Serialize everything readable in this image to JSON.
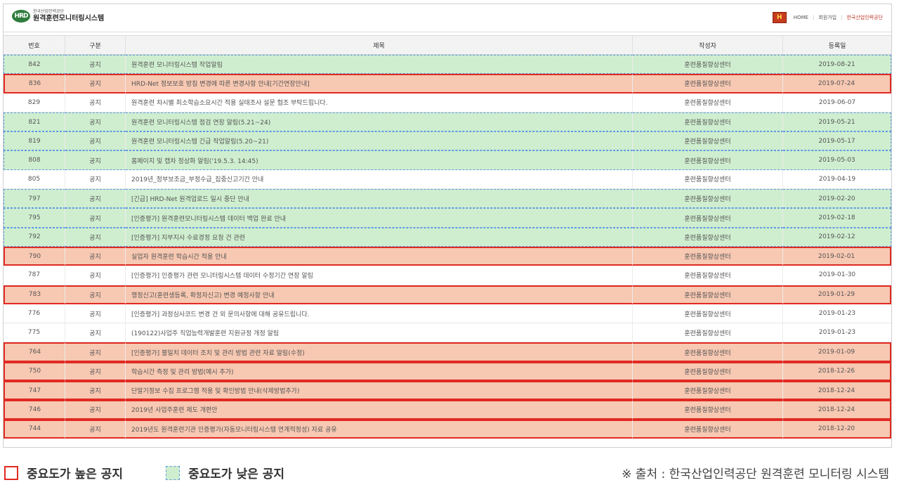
{
  "header": {
    "logo_small": "한국산업인력공단",
    "logo_main": "원격훈련모니터링시스템",
    "logo_mark": "HRD",
    "badge": "H",
    "links": [
      "HOME",
      "회원가입",
      "한국산업인력공단"
    ]
  },
  "table": {
    "columns": [
      "번호",
      "구분",
      "제목",
      "작성자",
      "등록일"
    ],
    "rows": [
      {
        "no": "842",
        "type": "공지",
        "title": "원격훈련 모니터링시스템 작업알림",
        "author": "훈련품질향상센터",
        "date": "2019-08-21",
        "importance": "low"
      },
      {
        "no": "836",
        "type": "공지",
        "title": "HRD-Net 정보보호 방침 변경에 따른 변경사항 안내[기간연장안내]",
        "author": "훈련품질향상센터",
        "date": "2019-07-24",
        "importance": "high"
      },
      {
        "no": "829",
        "type": "공지",
        "title": "원격훈련 차시별 최소학습소요시간 적용 실태조사 설문 협조 부탁드립니다.",
        "author": "훈련품질향상센터",
        "date": "2019-06-07",
        "importance": "none"
      },
      {
        "no": "821",
        "type": "공지",
        "title": "원격훈련 모니터링시스템 점검 연장 알림(5.21~24)",
        "author": "훈련품질향상센터",
        "date": "2019-05-21",
        "importance": "low"
      },
      {
        "no": "819",
        "type": "공지",
        "title": "원격훈련 모니터링시스템 긴급 작업알림(5.20~21)",
        "author": "훈련품질향상센터",
        "date": "2019-05-17",
        "importance": "low"
      },
      {
        "no": "808",
        "type": "공지",
        "title": "홈페이지 및 캡차 정상화 알림('19.5.3. 14:45)",
        "author": "훈련품질향상센터",
        "date": "2019-05-03",
        "importance": "low"
      },
      {
        "no": "805",
        "type": "공지",
        "title": "2019년_정부보조금_부정수급_집중신고기간 안내",
        "author": "훈련품질향상센터",
        "date": "2019-04-19",
        "importance": "none"
      },
      {
        "no": "797",
        "type": "공지",
        "title": "[긴급] HRD-Net 원격업로드 일시 중단 안내",
        "author": "훈련품질향상센터",
        "date": "2019-02-20",
        "importance": "low"
      },
      {
        "no": "795",
        "type": "공지",
        "title": "[인증평가] 원격훈련모니터링시스템 데이터 백업 완료 안내",
        "author": "훈련품질향상센터",
        "date": "2019-02-18",
        "importance": "low"
      },
      {
        "no": "792",
        "type": "공지",
        "title": "[인증평가] 지부지사 수료경정 요청 건 관련",
        "author": "훈련품질향상센터",
        "date": "2019-02-12",
        "importance": "low"
      },
      {
        "no": "790",
        "type": "공지",
        "title": "실업자 원격훈련 학습시간 적용 안내",
        "author": "훈련품질향상센터",
        "date": "2019-02-01",
        "importance": "high"
      },
      {
        "no": "787",
        "type": "공지",
        "title": "[인증평가] 인증평가 관련 모니터링시스템 데이터 수정기간 연장 알림",
        "author": "훈련품질향상센터",
        "date": "2019-01-30",
        "importance": "none"
      },
      {
        "no": "783",
        "type": "공지",
        "title": "행정신고(훈련생등록, 확정자신고) 변경 예정사항 안내",
        "author": "훈련품질향상센터",
        "date": "2019-01-29",
        "importance": "high"
      },
      {
        "no": "776",
        "type": "공지",
        "title": "[인증평가] 과정심사코드 변경 건 외 문의사항에 대해 공유드립니다.",
        "author": "훈련품질향상센터",
        "date": "2019-01-23",
        "importance": "none"
      },
      {
        "no": "775",
        "type": "공지",
        "title": "(190122)사업주 직업능력개발훈련 지원규정 개정 알림",
        "author": "훈련품질향상센터",
        "date": "2019-01-23",
        "importance": "none"
      },
      {
        "no": "764",
        "type": "공지",
        "title": "[인증평가] 불일치 데이터 조치 및 관리 방법 관련 자료 알림(수정)",
        "author": "훈련품질향상센터",
        "date": "2019-01-09",
        "importance": "high"
      },
      {
        "no": "750",
        "type": "공지",
        "title": "학습시간 측정 및 관리 방법(예시 추가)",
        "author": "훈련품질향상센터",
        "date": "2018-12-26",
        "importance": "high"
      },
      {
        "no": "747",
        "type": "공지",
        "title": "단말기정보 수집 프로그램 적용 및 확인방법 안내(삭제방법추가)",
        "author": "훈련품질향상센터",
        "date": "2018-12-24",
        "importance": "high"
      },
      {
        "no": "746",
        "type": "공지",
        "title": "2019년 사업주훈련 제도 개편안",
        "author": "훈련품질향상센터",
        "date": "2018-12-24",
        "importance": "high"
      },
      {
        "no": "744",
        "type": "공지",
        "title": "2019년도 원격훈련기관 인증평가(자동모니터링시스템 연계적정성) 자료 공유",
        "author": "훈련품질향상센터",
        "date": "2018-12-20",
        "importance": "high"
      }
    ]
  },
  "legend": {
    "high_label": "중요도가 높은 공지",
    "low_label": "중요도가 낮은 공지",
    "source": "※ 출처 : 한국산업인력공단 원격훈련 모니터링 시스템"
  },
  "colors": {
    "high_border": "#e02a22",
    "high_fill": "#f7c8b2",
    "low_border": "#5f9be0",
    "low_fill": "#cfeecf"
  }
}
